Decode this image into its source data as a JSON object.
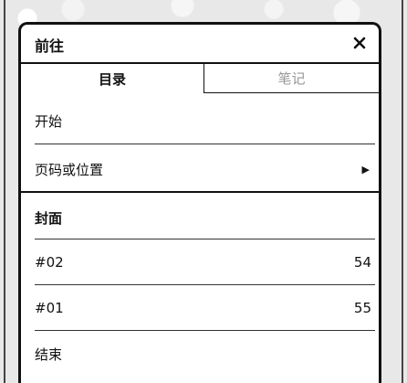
{
  "dialog": {
    "title": "前往",
    "close_label": "✕"
  },
  "tabs": [
    {
      "label": "目录",
      "active": true
    },
    {
      "label": "笔记",
      "active": false
    }
  ],
  "nav": {
    "start": "开始",
    "page_or_location": "页码或位置",
    "submenu_arrow": "▶"
  },
  "toc": {
    "items": [
      {
        "label": "封面",
        "page": ""
      },
      {
        "label": "#02",
        "page": "54"
      },
      {
        "label": "#01",
        "page": "55"
      },
      {
        "label": "结束",
        "page": ""
      }
    ]
  }
}
